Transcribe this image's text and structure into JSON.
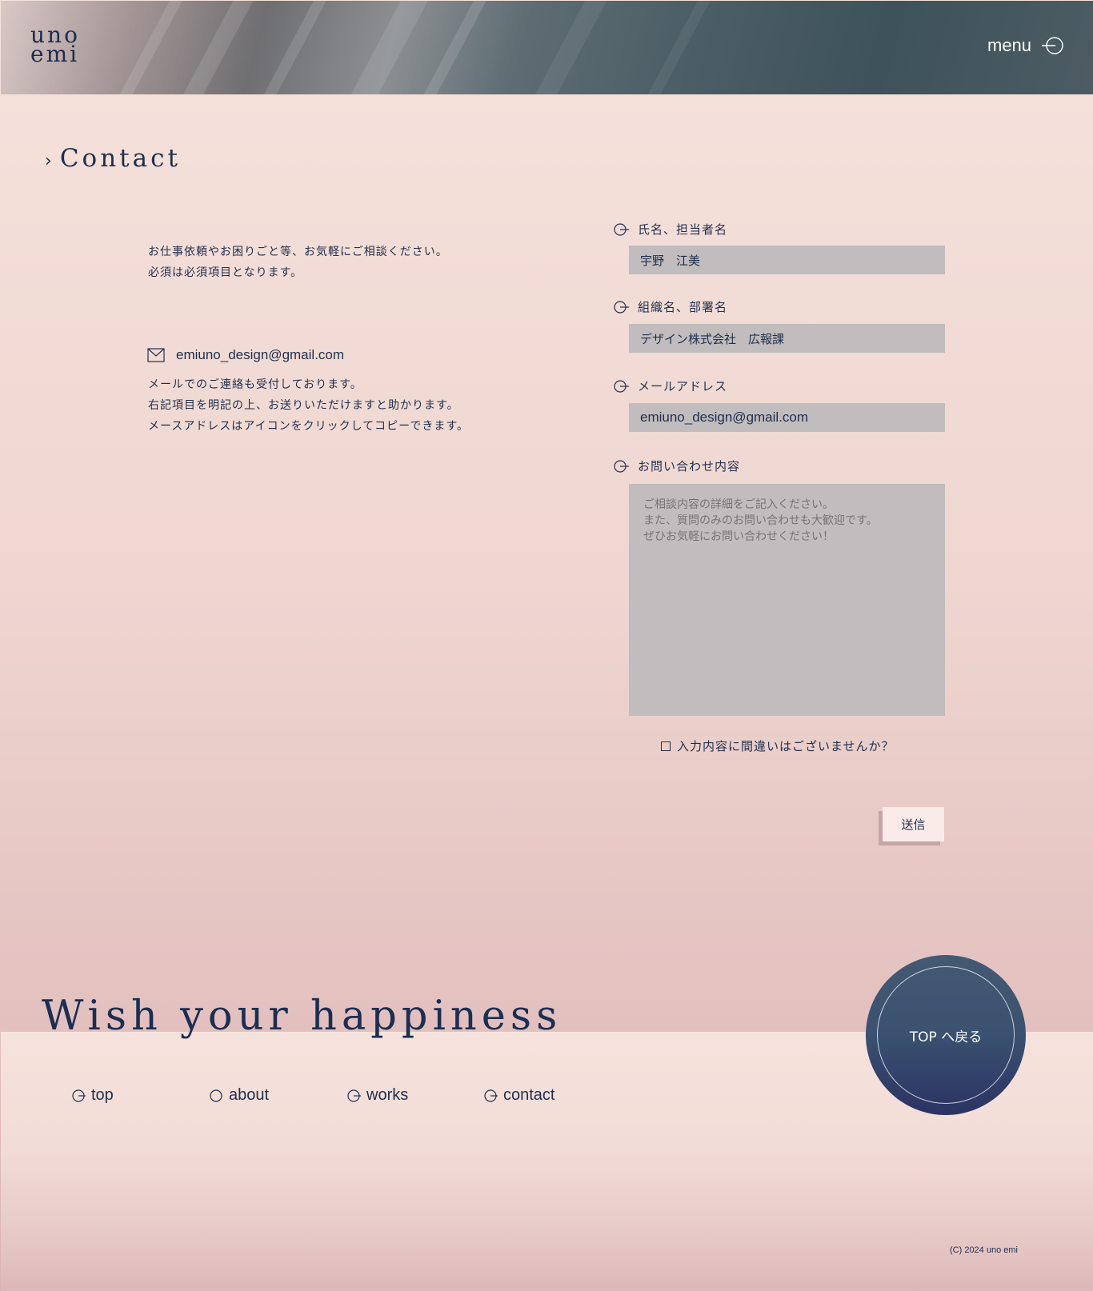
{
  "header": {
    "logo_top": "uno",
    "logo_bottom": "emi",
    "menu_label": "menu"
  },
  "contact": {
    "title": "Contact",
    "intro_line1": "お仕事依頼やお困りごと等、お気軽にご相談ください。",
    "intro_line2": "必須は必須項目となります。",
    "email": "emiuno_design@gmail.com",
    "note_line1": "メールでのご連絡も受付しております。",
    "note_line2": "右記項目を明記の上、お送りいただけますと助かります。",
    "note_line3": "メースアドレスはアイコンをクリックしてコピーできます。"
  },
  "form": {
    "name_label": "氏名、担当者名",
    "name_value": "宇野　江美",
    "org_label": "組織名、部署名",
    "org_value": "デザイン株式会社　広報課",
    "email_label": "メールアドレス",
    "email_value": "emiuno_design@gmail.com",
    "message_label": "お問い合わせ内容",
    "message_placeholder": "ご相談内容の詳細をご記入ください。\nまた、質問のみのお問い合わせも大歓迎です。\nぜひお気軽にお問い合わせください！",
    "confirm_label": "入力内容に間違いはございませんか？",
    "submit_label": "送信"
  },
  "footer": {
    "tagline": "Wish your happiness",
    "nav": [
      "top",
      "about",
      "works",
      "contact"
    ],
    "top_button": "TOP へ戻る",
    "copyright": "(C) 2024 uno emi"
  }
}
